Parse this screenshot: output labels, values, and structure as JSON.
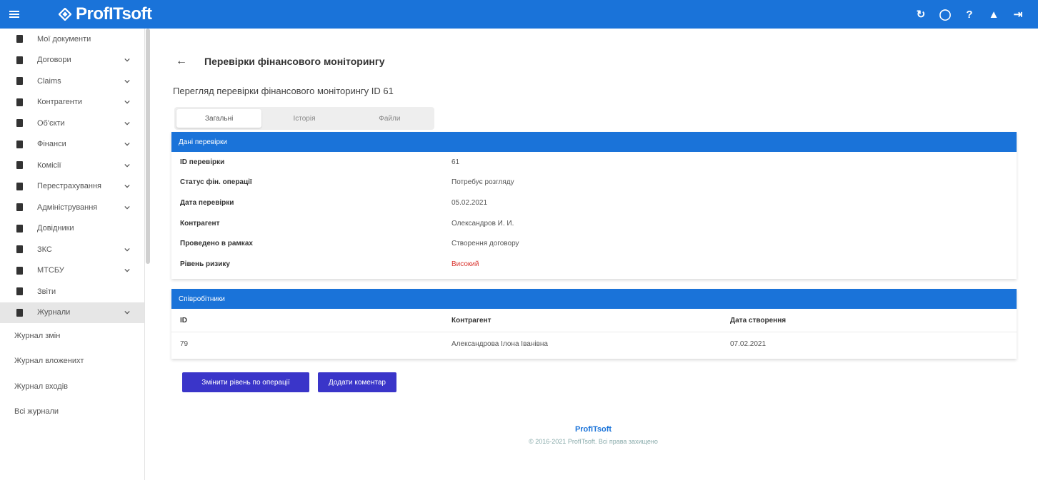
{
  "app": {
    "logo_text": "ProfITsoft",
    "brand_color": "#1a73d9",
    "button_color": "#3a35c9",
    "risk_color": "#d9352f"
  },
  "topbar": {
    "icons": [
      "refresh-icon",
      "chat-icon",
      "help-icon",
      "user-icon",
      "logout-icon"
    ],
    "icon_glyphs": [
      "↻",
      "◯",
      "?",
      "▲",
      "⇥"
    ]
  },
  "sidebar": {
    "items": [
      {
        "label": "Мої документи",
        "icon": "home-icon",
        "has_children": false
      },
      {
        "label": "Договори",
        "icon": "contract-icon",
        "has_children": true
      },
      {
        "label": "Claims",
        "icon": "document-icon",
        "has_children": true
      },
      {
        "label": "Контрагенти",
        "icon": "person-icon",
        "has_children": true
      },
      {
        "label": "Об'єкти",
        "icon": "box-icon",
        "has_children": true
      },
      {
        "label": "Фінанси",
        "icon": "money-icon",
        "has_children": true
      },
      {
        "label": "Комісії",
        "icon": "list-icon",
        "has_children": true
      },
      {
        "label": "Перестрахування",
        "icon": "exchange-icon",
        "has_children": true
      },
      {
        "label": "Адміністрування",
        "icon": "admin-icon",
        "has_children": true
      },
      {
        "label": "Довідники",
        "icon": "book-icon",
        "has_children": false
      },
      {
        "label": "ЗКС",
        "icon": "settings-icon",
        "has_children": true
      },
      {
        "label": "МТСБУ",
        "icon": "bank-icon",
        "has_children": true
      },
      {
        "label": "Звіти",
        "icon": "report-icon",
        "has_children": false
      },
      {
        "label": "Журнали",
        "icon": "journal-icon",
        "has_children": true,
        "active": true
      }
    ],
    "sub_items": [
      {
        "label": "Журнал змін"
      },
      {
        "label": "Журнал вложенихт"
      },
      {
        "label": "Журнал входів"
      },
      {
        "label": "Всі журнали"
      }
    ]
  },
  "main": {
    "title": "Перевірки фінансового моніторингу",
    "subtitle": "Перегляд перевірки фінансового моніторингу ID 61",
    "tabs": [
      {
        "label": "Загальні",
        "active": true
      },
      {
        "label": "Історія",
        "active": false
      },
      {
        "label": "Файли",
        "active": false
      }
    ],
    "details_card": {
      "header": "Дані перевірки",
      "rows": [
        {
          "label": "ID перевірки",
          "value": "61"
        },
        {
          "label": "Статус фін. операції",
          "value": "Потребує розгляду"
        },
        {
          "label": "Дата перевірки",
          "value": "05.02.2021"
        },
        {
          "label": "Контрагент",
          "value": "Олександров И. И."
        },
        {
          "label": "Проведено в рамках",
          "value": "Створення договору"
        },
        {
          "label": "Рівень ризику",
          "value": "Високий",
          "risk": true
        }
      ]
    },
    "participants_card": {
      "header": "Співробітники",
      "columns": [
        "ID",
        "Контрагент",
        "Дата створення"
      ],
      "rows": [
        [
          "79",
          "Александрова Ілона Іванівна",
          "07.02.2021"
        ]
      ]
    },
    "buttons": {
      "change_risk": "Змінити рівень по операції",
      "add_comment": "Додати коментар"
    },
    "footer": {
      "logo": "ProfITsoft",
      "copyright": "© 2016-2021 ProfITsoft. Всі права захищено"
    }
  }
}
